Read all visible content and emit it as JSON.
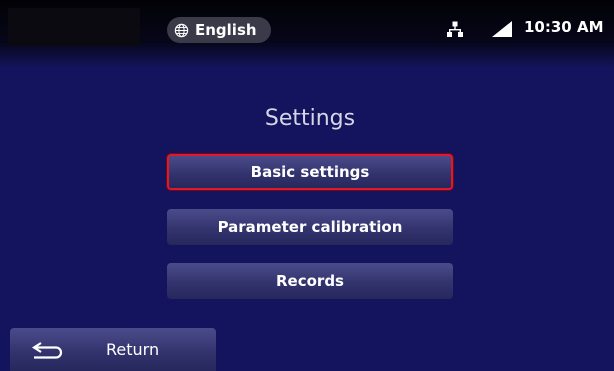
{
  "status_bar": {
    "language": "English",
    "time": "10:30 AM",
    "icons": [
      "globe-icon",
      "network-icon",
      "signal-icon"
    ]
  },
  "main": {
    "title": "Settings",
    "buttons": [
      {
        "label": "Basic settings",
        "selected": true
      },
      {
        "label": "Parameter calibration",
        "selected": false
      },
      {
        "label": "Records",
        "selected": false
      }
    ]
  },
  "footer": {
    "return_label": "Return",
    "return_icon": "return-arrow-icon"
  },
  "colors": {
    "background": "#14145e",
    "button": "#33346e",
    "selected_border": "#e0182a",
    "text": "#ffffff"
  }
}
